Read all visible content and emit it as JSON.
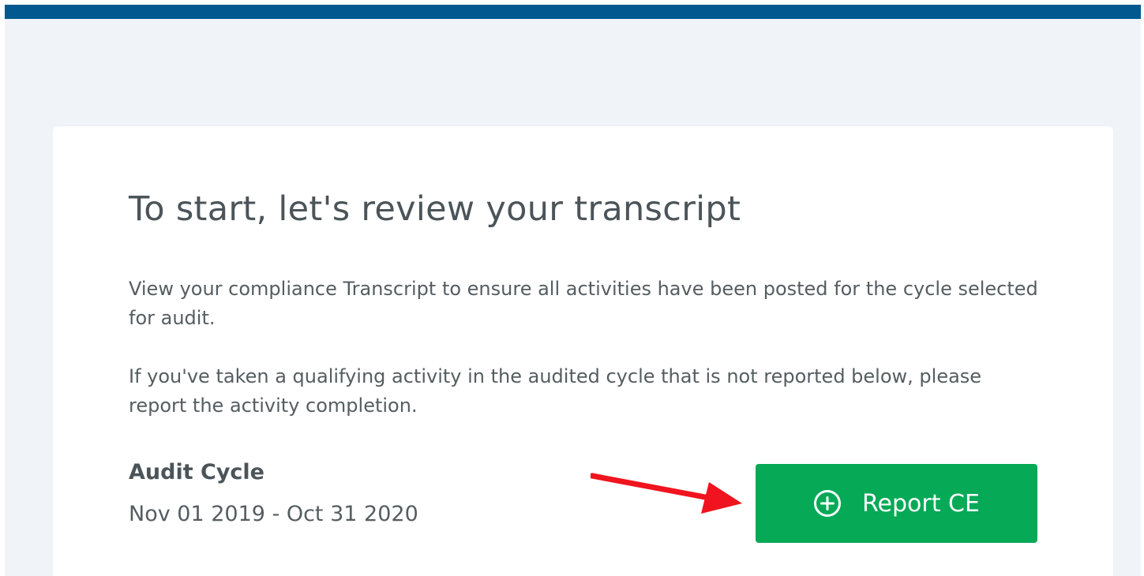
{
  "heading": {
    "title": "To start, let's review your transcript"
  },
  "intro": {
    "paragraph_1": "View your compliance Transcript to ensure all activities have been posted for the cycle selected for audit.",
    "paragraph_2": "If you've taken a qualifying activity in the audited cycle that is not reported below, please report the activity completion."
  },
  "audit_cycle": {
    "label": "Audit Cycle",
    "dates": "Nov 01 2019 - Oct 31 2020"
  },
  "actions": {
    "report_button_label": "Report CE",
    "report_button_icon": "plus-circle-icon"
  },
  "annotation": {
    "icon": "red-arrow-icon"
  },
  "colors": {
    "header_bar": "#02588f",
    "page_background": "#f0f3f8",
    "card_background": "#ffffff",
    "primary_button": "#05a956",
    "annotation_arrow": "#f0141e"
  }
}
